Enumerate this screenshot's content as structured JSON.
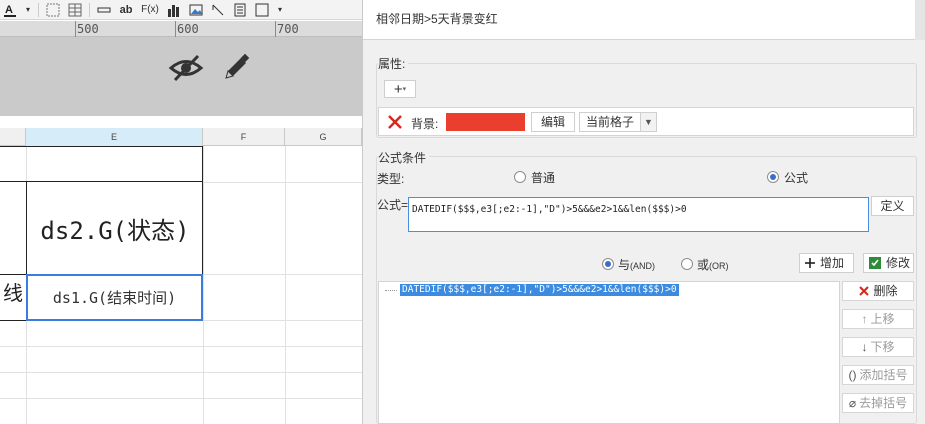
{
  "ruler": {
    "labels": [
      "500",
      "600",
      "700"
    ]
  },
  "spreadsheet": {
    "columns": [
      "E",
      "F",
      "G"
    ],
    "cells": {
      "header": "ds2.G(状态)",
      "selected": "ds1.G(结束时间)",
      "partial_left": "线"
    }
  },
  "toolbar_icons": [
    "font-color-icon",
    "border-icon",
    "table-icon",
    "underline-icon",
    "text-ab-icon",
    "formula-icon",
    "chart-icon",
    "image-icon",
    "slash-icon",
    "document-icon",
    "border-box-icon"
  ],
  "toolbar_text": {
    "ab": "ab",
    "fx": "F(x)"
  },
  "dialog": {
    "title": "相邻日期>5天背景变红",
    "properties": {
      "section_label": "属性:",
      "add_button": "+",
      "background_label": "背景:",
      "background_color": "#ea3e2e",
      "edit_button": "编辑",
      "scope_value": "当前格子"
    },
    "conditions": {
      "section_label": "公式条件",
      "type_label": "类型:",
      "type_options": [
        "普通",
        "公式"
      ],
      "type_selected": "公式",
      "formula_label": "公式=",
      "formula_value": "DATEDIF($$$,e3[;e2:-1],\"D\")>5&&&e2>1&&len($$$)>0",
      "define_button": "定义",
      "logic_options": [
        {
          "label": "与",
          "suffix": "(AND)",
          "selected": true
        },
        {
          "label": "或",
          "suffix": "(OR)",
          "selected": false
        }
      ],
      "add_button": "增加",
      "modify_button": "修改",
      "list_items": [
        "DATEDIF($$$,e3[;e2:-1],\"D\")>5&&&e2>1&&len($$$)>0"
      ],
      "side_buttons": [
        "删除",
        "上移",
        "下移",
        "添加括号",
        "去掉括号"
      ]
    }
  }
}
